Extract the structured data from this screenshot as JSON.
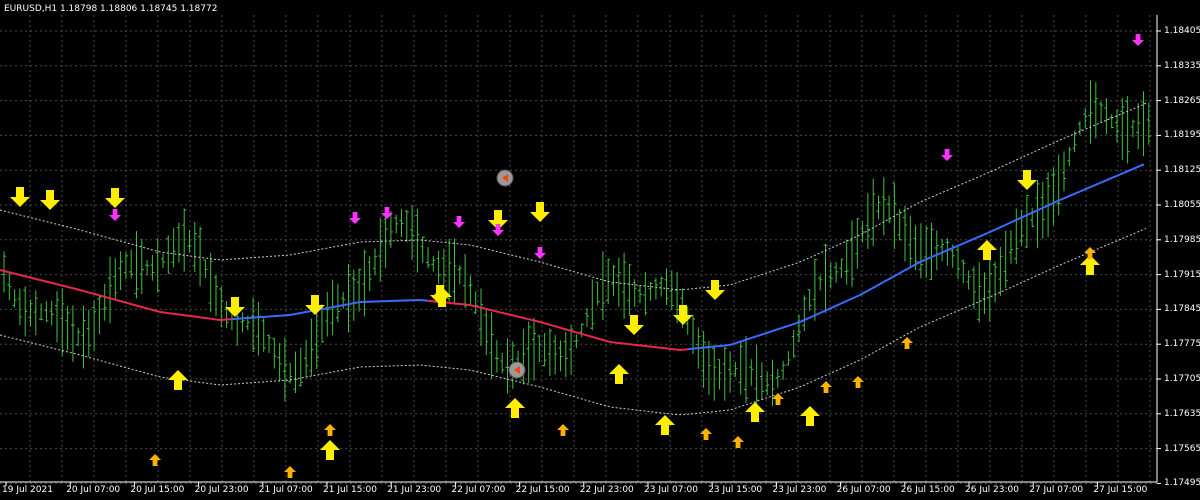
{
  "window": {
    "title": "EURUSD,H1  1.18798 1.18806 1.18745 1.18772"
  },
  "colors": {
    "background": "#000000",
    "grid": "#4a4a4a",
    "bars": "#3fbf3f",
    "ma_bearish": "#e8284c",
    "ma_bullish": "#3a6cff",
    "envelope": "#cfcfcf",
    "signal_big": "#ffee00",
    "signal_small": "#ffb300",
    "signal_magenta": "#ff33ff",
    "axis_text": "#ffffff"
  },
  "price_axis": {
    "labels": [
      "1.18405",
      "1.18335",
      "1.18265",
      "1.18195",
      "1.18125",
      "1.18055",
      "1.17985",
      "1.17915",
      "1.17845",
      "1.17775",
      "1.17705",
      "1.17635",
      "1.17565",
      "1.17495"
    ]
  },
  "time_axis": {
    "labels": [
      "19 Jul 2021",
      "20 Jul 07:00",
      "20 Jul 15:00",
      "20 Jul 23:00",
      "21 Jul 07:00",
      "21 Jul 15:00",
      "21 Jul 23:00",
      "22 Jul 07:00",
      "22 Jul 15:00",
      "22 Jul 23:00",
      "23 Jul 07:00",
      "23 Jul 15:00",
      "23 Jul 23:00",
      "26 Jul 07:00",
      "26 Jul 15:00",
      "26 Jul 23:00",
      "27 Jul 07:00",
      "27 Jul 15:00"
    ]
  },
  "signals": {
    "big_down": [
      [
        20,
        197
      ],
      [
        50,
        200
      ],
      [
        115,
        198
      ],
      [
        235,
        307
      ],
      [
        315,
        305
      ],
      [
        440,
        295
      ],
      [
        498,
        220
      ],
      [
        540,
        212
      ],
      [
        634,
        325
      ],
      [
        683,
        315
      ],
      [
        715,
        290
      ],
      [
        1027,
        180
      ]
    ],
    "big_up": [
      [
        178,
        380
      ],
      [
        330,
        450
      ],
      [
        442,
        297
      ],
      [
        515,
        408
      ],
      [
        619,
        374
      ],
      [
        665,
        425
      ],
      [
        755,
        412
      ],
      [
        810,
        416
      ],
      [
        987,
        250
      ],
      [
        1090,
        265
      ]
    ],
    "small_up": [
      [
        155,
        460
      ],
      [
        290,
        472
      ],
      [
        330,
        430
      ],
      [
        563,
        430
      ],
      [
        706,
        434
      ],
      [
        738,
        442
      ],
      [
        778,
        399
      ],
      [
        826,
        387
      ],
      [
        858,
        382
      ],
      [
        907,
        343
      ],
      [
        1090,
        253
      ]
    ],
    "magenta_down": [
      [
        115,
        215
      ],
      [
        355,
        218
      ],
      [
        387,
        213
      ],
      [
        459,
        222
      ],
      [
        498,
        230
      ],
      [
        540,
        253
      ],
      [
        947,
        155
      ],
      [
        1138,
        40
      ]
    ],
    "circles": [
      [
        505,
        178
      ],
      [
        517,
        370
      ]
    ]
  },
  "icons": {
    "arrow_up": "arrow-up-icon",
    "arrow_down": "arrow-down-icon",
    "trade_marker": "trade-marker-icon"
  }
}
